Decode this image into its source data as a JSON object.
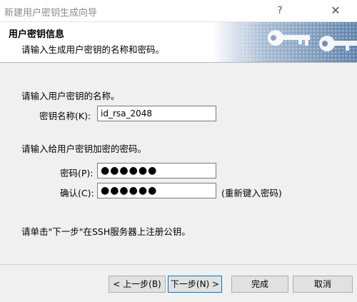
{
  "window": {
    "title": "新建用户密钥生成向导",
    "help": "?",
    "close": "✕"
  },
  "header": {
    "title": "用户密钥信息",
    "subtitle": "请输入生成用户密钥的名称和密码。"
  },
  "name_section": {
    "prompt": "请输入用户密钥的名称。",
    "key_name_label": "密钥名称(K):",
    "key_name_value": "id_rsa_2048"
  },
  "password_section": {
    "prompt": "请输入给用户密钥加密的密码。",
    "password_label": "密码(P):",
    "password_value": "●●●●●●",
    "confirm_label": "确认(C):",
    "confirm_value": "●●●●●●",
    "reenter_hint": "(重新键入密码)"
  },
  "note": "请单击\"下一步\"在SSH服务器上注册公钥。",
  "buttons": {
    "back": "< 上一步(B)",
    "next": "下一步(N) >",
    "finish": "完成",
    "cancel": "取消"
  },
  "colors": {
    "accent": "#0078d7",
    "banner": "#6a8db3"
  }
}
